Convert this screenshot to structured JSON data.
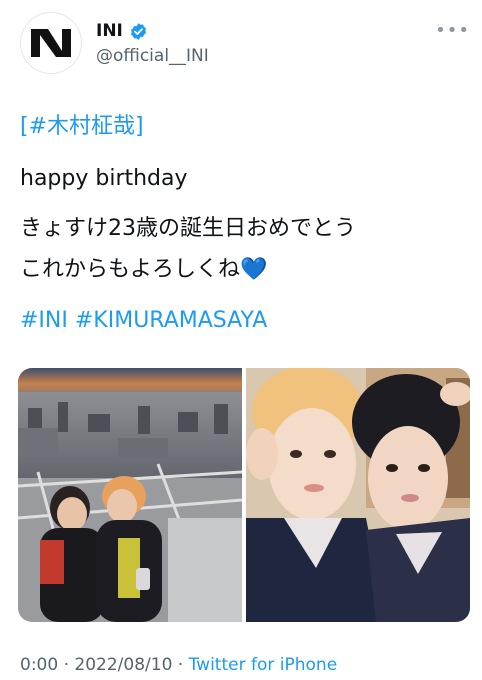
{
  "author": {
    "display_name": "INI",
    "handle": "@official__INI",
    "verified_icon": "verified-badge-icon",
    "avatar_logo": "INI logo",
    "more_icon": "more-dots-icon"
  },
  "tweet": {
    "hashtag_name_open": "[",
    "hashtag_name": "#木村柾哉",
    "hashtag_name_close": "]",
    "line_birthday": "happy birthday",
    "line_jp1": "きょすけ23歳の誕生日おめでとう",
    "line_jp2": "これからもよろしくね",
    "heart": "💙",
    "hashtag_ini": "#INI",
    "hashtag_kimura": "#KIMURAMASAYA"
  },
  "media": {
    "photo1": "rooftop-photo",
    "photo2": "selfie-photo"
  },
  "meta": {
    "time": "0:00",
    "sep1": " · ",
    "date": "2022/08/10",
    "sep2": " · ",
    "source": "Twitter for iPhone"
  },
  "colors": {
    "link": "#1d9bf0",
    "text": "#0f1419",
    "secondary": "#536471"
  }
}
